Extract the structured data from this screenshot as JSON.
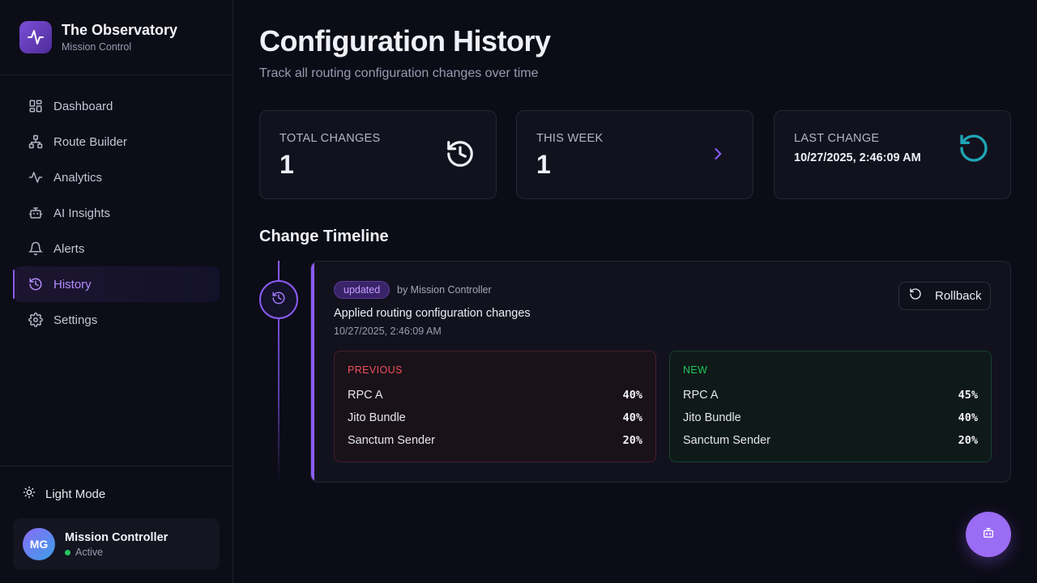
{
  "brand": {
    "title": "The Observatory",
    "subtitle": "Mission Control"
  },
  "sidebar": {
    "items": [
      {
        "label": "Dashboard",
        "icon": "layout-grid-icon"
      },
      {
        "label": "Route Builder",
        "icon": "network-icon"
      },
      {
        "label": "Analytics",
        "icon": "activity-icon"
      },
      {
        "label": "AI Insights",
        "icon": "bot-icon"
      },
      {
        "label": "Alerts",
        "icon": "bell-icon"
      },
      {
        "label": "History",
        "icon": "history-icon",
        "active": true
      },
      {
        "label": "Settings",
        "icon": "gear-icon"
      }
    ],
    "theme_toggle": "Light Mode",
    "user": {
      "initials": "MG",
      "name": "Mission Controller",
      "status": "Active"
    }
  },
  "page": {
    "title": "Configuration History",
    "subtitle": "Track all routing configuration changes over time"
  },
  "stats": [
    {
      "label": "TOTAL CHANGES",
      "value": "1",
      "icon": "history-icon"
    },
    {
      "label": "THIS WEEK",
      "value": "1",
      "icon": "chevron-right-icon"
    },
    {
      "label": "LAST CHANGE",
      "value": "10/27/2025, 2:46:09 AM",
      "icon": "rotate-ccw-icon"
    }
  ],
  "timeline": {
    "title": "Change Timeline",
    "entries": [
      {
        "badge": "updated",
        "author": "by Mission Controller",
        "description": "Applied routing configuration changes",
        "timestamp": "10/27/2025, 2:46:09 AM",
        "rollback_label": "Rollback",
        "previous": {
          "title": "PREVIOUS",
          "rows": [
            {
              "name": "RPC A",
              "pct": "40%"
            },
            {
              "name": "Jito Bundle",
              "pct": "40%"
            },
            {
              "name": "Sanctum Sender",
              "pct": "20%"
            }
          ]
        },
        "new": {
          "title": "NEW",
          "rows": [
            {
              "name": "RPC A",
              "pct": "45%"
            },
            {
              "name": "Jito Bundle",
              "pct": "40%"
            },
            {
              "name": "Sanctum Sender",
              "pct": "20%"
            }
          ]
        }
      }
    ]
  },
  "colors": {
    "accent": "#8b5cf6",
    "previous": "#f0505a",
    "new": "#22c55e",
    "teal": "#1fa5b5"
  },
  "fab": {
    "icon": "bot-icon"
  }
}
